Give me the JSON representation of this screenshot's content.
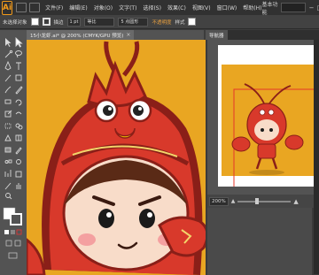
{
  "app": {
    "logo": "Ai"
  },
  "menu": {
    "items": [
      "文件(F)",
      "编辑(E)",
      "对象(O)",
      "文字(T)",
      "选择(S)",
      "效果(C)",
      "视图(V)",
      "窗口(W)",
      "帮助(H)"
    ],
    "workspace_label": "基本功能",
    "window_buttons": [
      "−",
      "□",
      "×"
    ]
  },
  "control": {
    "selection_label": "未选择对象",
    "stroke_label": "描边",
    "stroke_value": "1 pt",
    "profile_label": "等比",
    "brush_label": "5 点圆形",
    "opacity_label": "不透明度",
    "style_label": "样式"
  },
  "document": {
    "tab_title": "15小龙虾.ai* @ 200% (CMYK/GPU 预览)",
    "close": "×"
  },
  "navigator": {
    "tab_label": "导航器",
    "zoom_value": "200%"
  },
  "colors": {
    "canvas_bg": "#e9a622",
    "lobster_red": "#d8392b",
    "lobster_dark": "#8a1f18",
    "face": "#f8dcc9",
    "panel_bg": "#535353"
  },
  "icons": [
    "selection-icon",
    "direct-select-icon",
    "magic-wand-icon",
    "lasso-icon",
    "pen-icon",
    "type-icon",
    "line-icon",
    "rectangle-icon",
    "paintbrush-icon",
    "pencil-icon",
    "eraser-icon",
    "rotate-icon",
    "scale-icon",
    "width-icon",
    "free-transform-icon",
    "shape-builder-icon",
    "perspective-icon",
    "mesh-icon",
    "gradient-icon",
    "eyedropper-icon",
    "blend-icon",
    "symbol-sprayer-icon",
    "graph-icon",
    "artboard-icon",
    "slice-icon",
    "hand-icon",
    "zoom-icon"
  ]
}
